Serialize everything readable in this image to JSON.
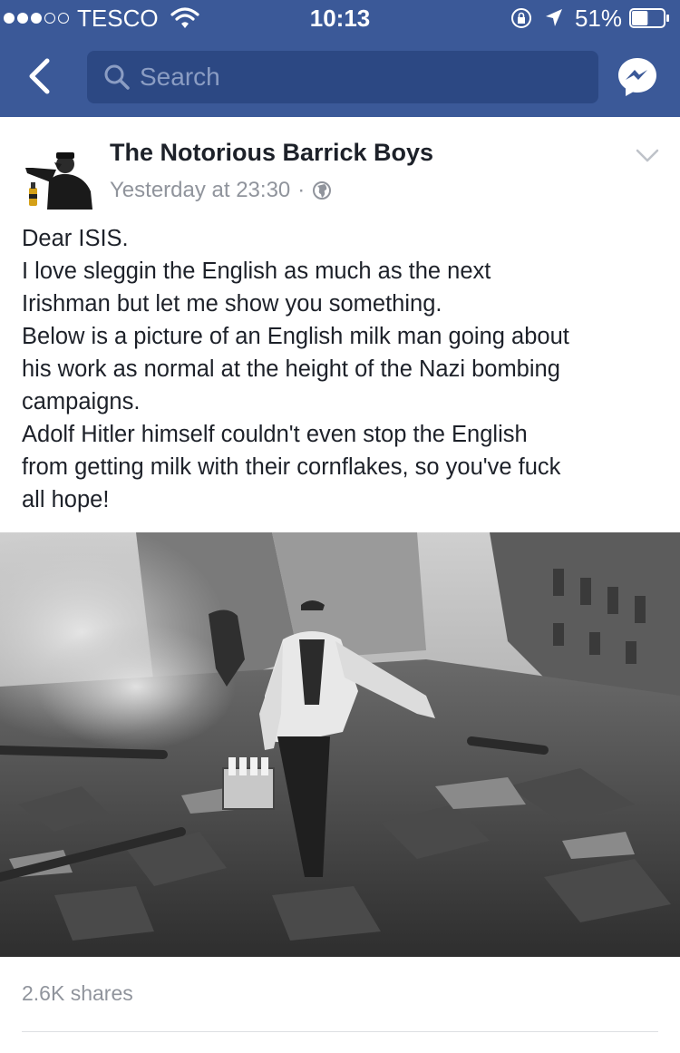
{
  "status_bar": {
    "carrier": "TESCO",
    "time": "10:13",
    "battery": "51%",
    "signal_bars": 3,
    "signal_total": 5,
    "battery_level": 0.51
  },
  "nav": {
    "search_placeholder": "Search",
    "icons": [
      "back-chevron-icon",
      "search-icon",
      "messenger-icon"
    ]
  },
  "post": {
    "page_name": "The Notorious Barrick Boys",
    "timestamp": "Yesterday at 23:30",
    "separator": "·",
    "privacy_icon": "globe-icon",
    "text_lines": [
      "Dear ISIS.",
      "I love sleggin the English as much as the next",
      "Irishman but let me show you something.",
      "Below is a picture of an English milk man going about",
      "his work as normal at the height of the Nazi bombing",
      "campaigns.",
      "Adolf Hitler himself couldn't even stop the English",
      "from getting milk with their cornflakes, so you've fuck",
      "all hope!"
    ],
    "shares": "2.6K shares"
  },
  "colors": {
    "facebook_blue": "#3b5998",
    "search_bg": "#2c4883",
    "text_primary": "#1d2129",
    "text_secondary": "#90949c"
  }
}
